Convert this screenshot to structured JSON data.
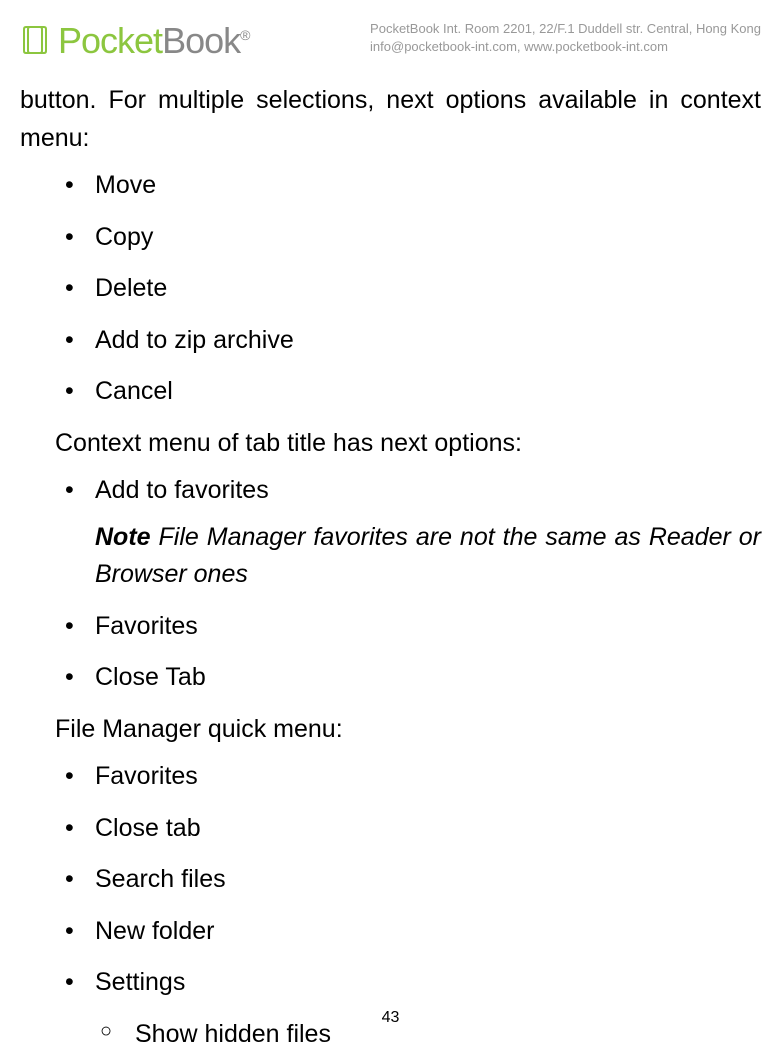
{
  "header": {
    "logo_pocket": "Pocket",
    "logo_book": "Book",
    "logo_reg": "®",
    "company_address": "PocketBook Int. Room 2201, 22/F.1 Duddell str. Central, Hong Kong",
    "company_contact": "info@pocketbook-int.com, www.pocketbook-int.com"
  },
  "content": {
    "intro": "button. For multiple selections, next options available in context menu:",
    "list1": {
      "item1": "Move",
      "item2": "Copy",
      "item3": "Delete",
      "item4": "Add to zip archive",
      "item5": "Cancel"
    },
    "section1": "Context menu of tab title has next options:",
    "list2": {
      "item1": "Add to favorites"
    },
    "note_label": "Note",
    "note_text": " File Manager favorites are not the same as Reader or Browser ones",
    "list2b": {
      "item1": "Favorites",
      "item2": "Close Tab"
    },
    "section2": "File Manager quick menu:",
    "list3": {
      "item1": "Favorites",
      "item2": "Close tab",
      "item3": "Search files",
      "item4": "New folder",
      "item5": "Settings"
    },
    "sublist": {
      "item1": "Show hidden files"
    }
  },
  "page_number": "43"
}
